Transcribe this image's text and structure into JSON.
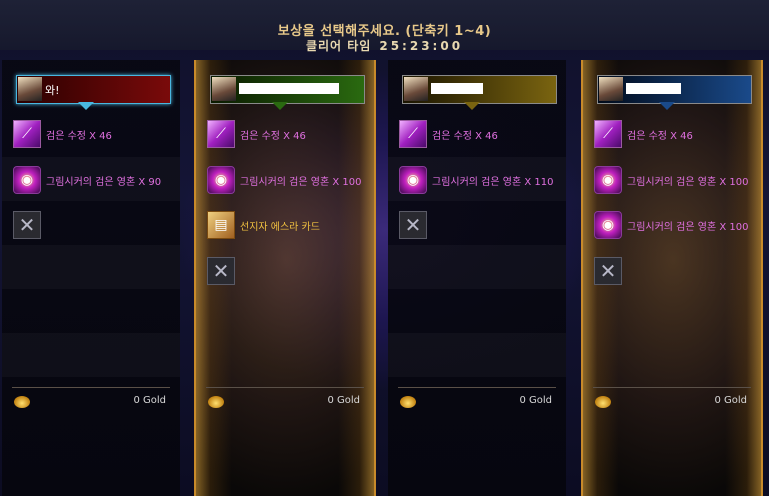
{
  "header": {
    "title": "보상을 선택해주세요. (단축키 1~4)",
    "clear_time_label": "클리어 타임",
    "clear_time_value": "25:23:00"
  },
  "columns": [
    {
      "name": "와!",
      "name_color": "red",
      "selected": false,
      "items": [
        {
          "icon": "crystal-icon",
          "label": "검은 수정 X 46"
        },
        {
          "icon": "soul-icon",
          "label": "그림시커의 검은 영혼 X 90"
        },
        {
          "icon": "empty-slot-icon",
          "label": ""
        }
      ],
      "gold": "0 Gold"
    },
    {
      "name": "",
      "name_color": "green",
      "selected": true,
      "items": [
        {
          "icon": "crystal-icon",
          "label": "검은 수정 X 46"
        },
        {
          "icon": "soul-icon",
          "label": "그림시커의 검은 영혼 X 100"
        },
        {
          "icon": "card-icon",
          "label": "선지자 에스라 카드"
        },
        {
          "icon": "empty-slot-icon",
          "label": ""
        }
      ],
      "gold": "0 Gold"
    },
    {
      "name": "",
      "name_color": "yellow",
      "selected": false,
      "items": [
        {
          "icon": "crystal-icon",
          "label": "검은 수정 X 46"
        },
        {
          "icon": "soul-icon",
          "label": "그림시커의 검은 영혼 X 110"
        },
        {
          "icon": "empty-slot-icon",
          "label": ""
        }
      ],
      "gold": "0 Gold"
    },
    {
      "name": "",
      "name_color": "blue",
      "selected": true,
      "items": [
        {
          "icon": "crystal-icon",
          "label": "검은 수정 X 46"
        },
        {
          "icon": "soul-icon",
          "label": "그림시커의 검은 영혼 X 100"
        },
        {
          "icon": "soul-icon",
          "label": "그림시커의 검은 영혼 X 100"
        },
        {
          "icon": "empty-slot-icon",
          "label": ""
        }
      ],
      "gold": "0 Gold"
    }
  ],
  "colors": {
    "accent_gold": "#c88a2a",
    "item_text": "#e070e0",
    "card_text": "#f0c040",
    "selected_border": "#49b7e0"
  }
}
